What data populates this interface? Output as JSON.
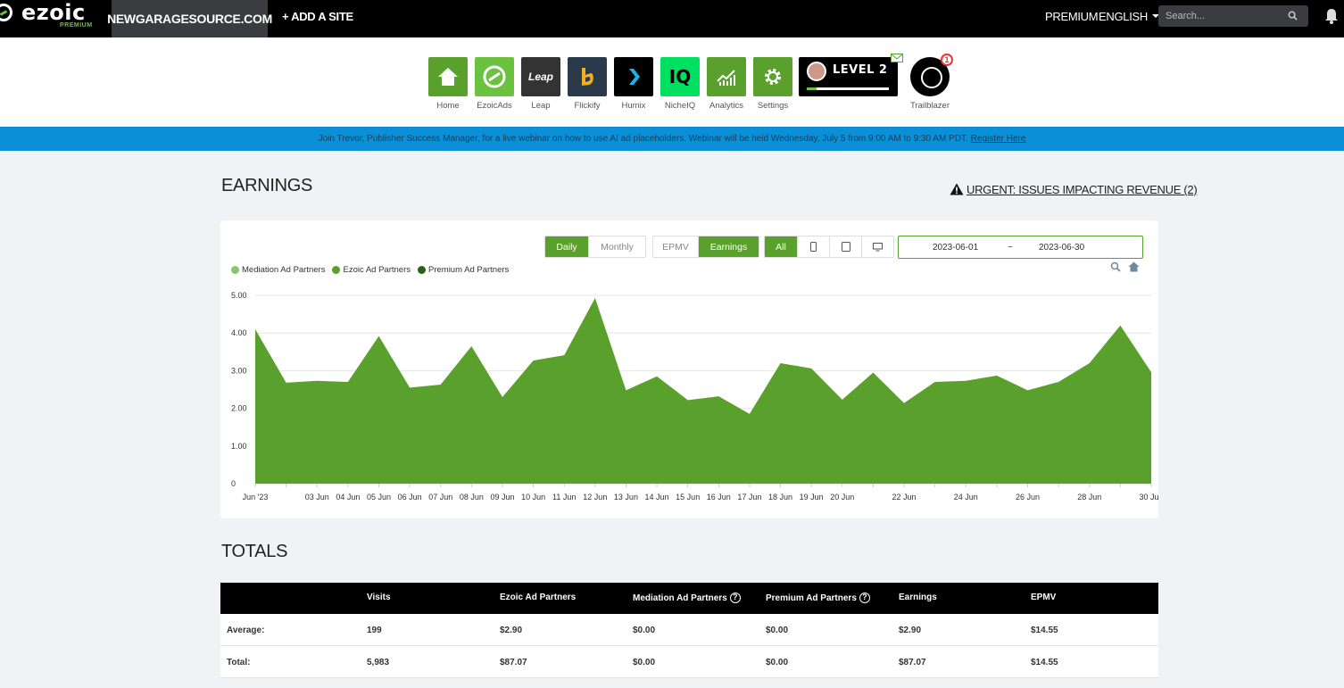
{
  "topbar": {
    "logo_text": "ezoic",
    "logo_sub": "PREMIUM",
    "site_name": "NEWGARAGESOURCE.COM",
    "add_site": "+ ADD A SITE",
    "premium": "PREMIUM",
    "language": "ENGLISH",
    "search_placeholder": "Search..."
  },
  "apps": [
    {
      "label": "Home",
      "icon": "home-icon",
      "color": "#5aa02c"
    },
    {
      "label": "EzoicAds",
      "icon": "ezoicads-icon",
      "color": "#6bc23f"
    },
    {
      "label": "Leap",
      "icon": "leap-icon",
      "color": "#333333",
      "tile_text": "Leap"
    },
    {
      "label": "Flickify",
      "icon": "flickify-icon",
      "color": "#2b3a4a"
    },
    {
      "label": "Humix",
      "icon": "humix-icon",
      "color": "#000000"
    },
    {
      "label": "NicheIQ",
      "icon": "nicheiq-icon",
      "color": "#00e060",
      "tile_text": "IQ"
    },
    {
      "label": "Analytics",
      "icon": "analytics-icon",
      "color": "#5aa02c"
    },
    {
      "label": "Settings",
      "icon": "settings-icon",
      "color": "#5aa02c"
    }
  ],
  "level": {
    "text": "LEVEL 2",
    "progress": 0.12
  },
  "trailblazer": {
    "label": "Trailblazer",
    "badge": "1"
  },
  "banner": {
    "text": "Join Trevor, Publisher Success Manager, for a live webinar on how to use AI ad placeholders. Webinar will be held Wednesday, July 5 from 9:00 AM to 9:30 AM PDT.",
    "link": "Register Here"
  },
  "earnings": {
    "title": "EARNINGS",
    "urgent": "URGENT: ISSUES IMPACTING REVENUE (2)"
  },
  "controls": {
    "period": [
      "Daily",
      "Monthly"
    ],
    "metric": [
      "EPMV",
      "Earnings"
    ],
    "device_all": "All",
    "device_icons": [
      "phone-icon",
      "tablet-icon",
      "desktop-icon"
    ],
    "date_start": "2023-06-01",
    "date_sep": "~",
    "date_end": "2023-06-30"
  },
  "colors": {
    "accent": "#5aa02c",
    "mediation": "#8bc56a",
    "ezoic": "#5aa02c",
    "premium": "#2d5e17",
    "banner": "#0b8fd6"
  },
  "chart_data": {
    "type": "area",
    "series": [
      {
        "name": "Mediation Ad Partners",
        "values": [
          0,
          0,
          0,
          0,
          0,
          0,
          0,
          0,
          0,
          0,
          0,
          0,
          0,
          0,
          0,
          0,
          0,
          0,
          0,
          0,
          0,
          0,
          0,
          0,
          0,
          0,
          0,
          0,
          0,
          0
        ]
      },
      {
        "name": "Ezoic Ad Partners",
        "values": [
          4.1,
          2.68,
          2.73,
          2.7,
          3.92,
          2.55,
          2.63,
          3.65,
          2.3,
          3.27,
          3.41,
          4.93,
          2.48,
          2.85,
          2.22,
          2.32,
          1.85,
          3.2,
          3.06,
          2.23,
          2.95,
          2.14,
          2.7,
          2.73,
          2.87,
          2.48,
          2.7,
          3.2,
          4.2,
          2.96
        ]
      },
      {
        "name": "Premium Ad Partners",
        "values": [
          0,
          0,
          0,
          0,
          0,
          0,
          0,
          0,
          0,
          0,
          0,
          0,
          0,
          0,
          0,
          0,
          0,
          0,
          0,
          0,
          0,
          0,
          0,
          0,
          0,
          0,
          0,
          0,
          0,
          0
        ]
      }
    ],
    "x_tick_labels": [
      "Jun '23",
      "",
      "03 Jun",
      "04 Jun",
      "05 Jun",
      "06 Jun",
      "07 Jun",
      "08 Jun",
      "09 Jun",
      "10 Jun",
      "11 Jun",
      "12 Jun",
      "13 Jun",
      "14 Jun",
      "15 Jun",
      "16 Jun",
      "17 Jun",
      "18 Jun",
      "19 Jun",
      "20 Jun",
      "",
      "22 Jun",
      "",
      "24 Jun",
      "",
      "26 Jun",
      "",
      "28 Jun",
      "",
      "30 Jun"
    ],
    "y_ticks": [
      "0",
      "1.00",
      "2.00",
      "3.00",
      "4.00",
      "5.00"
    ],
    "ylim": [
      0,
      5
    ],
    "legend_position": "top-left",
    "grid": true
  },
  "totals": {
    "title": "TOTALS",
    "headers": [
      "Visits",
      "Ezoic Ad Partners",
      "Mediation Ad Partners",
      "Premium Ad Partners",
      "Earnings",
      "EPMV"
    ],
    "rows": [
      {
        "label": "Average:",
        "values": [
          "199",
          "$2.90",
          "$0.00",
          "$0.00",
          "$2.90",
          "$14.55"
        ]
      },
      {
        "label": "Total:",
        "values": [
          "5,983",
          "$87.07",
          "$0.00",
          "$0.00",
          "$87.07",
          "$14.55"
        ]
      }
    ]
  }
}
